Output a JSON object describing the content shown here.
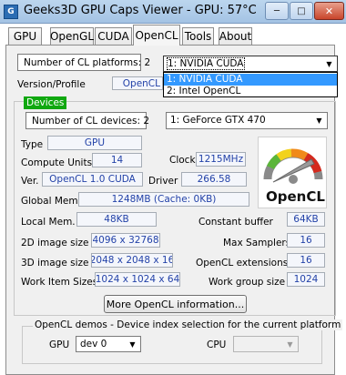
{
  "window": {
    "title": "Geeks3D GPU Caps Viewer - GPU: 57°C",
    "icon_label": "G",
    "controls": {
      "minimize": "─",
      "maximize": "□",
      "close": "✕"
    }
  },
  "tabs": [
    {
      "label": "GPU"
    },
    {
      "label": "OpenGL"
    },
    {
      "label": "CUDA"
    },
    {
      "label": "OpenCL",
      "active": true
    },
    {
      "label": "Tools"
    },
    {
      "label": "About"
    }
  ],
  "platform": {
    "count_label": "Number of CL platforms: 2",
    "selected": "1: NVIDIA CUDA",
    "options": [
      "1: NVIDIA CUDA",
      "2: Intel OpenCL"
    ],
    "version_label": "Version/Profile",
    "version_value": "OpenCL"
  },
  "devices": {
    "group_title": "Devices",
    "count_label": "Number of CL devices: 2",
    "selected": "1: GeForce GTX 470",
    "type_label": "Type",
    "type_value": "GPU",
    "compute_units_label": "Compute Units",
    "compute_units_value": "14",
    "clock_label": "Clock",
    "clock_value": "1215MHz",
    "ver_label": "Ver.",
    "ver_value": "OpenCL 1.0 CUDA",
    "driver_label": "Driver",
    "driver_value": "266.58",
    "global_mem_label": "Global Mem.",
    "global_mem_value": "1248MB (Cache: 0KB)",
    "local_mem_label": "Local Mem.",
    "local_mem_value": "48KB",
    "constant_buffer_label": "Constant buffer",
    "constant_buffer_value": "64KB",
    "image2d_label": "2D image size",
    "image2d_value": "4096 x 32768",
    "max_samplers_label": "Max Samplers",
    "max_samplers_value": "16",
    "image3d_label": "3D image size",
    "image3d_value": "2048 x 2048 x 16",
    "extensions_label": "OpenCL extensions",
    "extensions_value": "16",
    "work_item_label": "Work Item Sizes",
    "work_item_value": "1024 x 1024 x 64",
    "work_group_label": "Work group size",
    "work_group_value": "1024",
    "more_info_button": "More OpenCL information..."
  },
  "logo": {
    "text": "OpenCL",
    "colors": {
      "accent_red": "#d42a1e",
      "accent_orange": "#f08a1a",
      "accent_yellow": "#f2d21c",
      "accent_green": "#5bb53a",
      "dial_gray": "#8a8a8a"
    }
  },
  "demos": {
    "group_title": "OpenCL demos - Device index selection for the current platform",
    "gpu_label": "GPU",
    "gpu_selected": "dev 0",
    "cpu_label": "CPU",
    "cpu_selected": ""
  },
  "colors": {
    "group_title_bg": "#10a810",
    "selection_bg": "#3399ff",
    "value_text": "#2342a8"
  }
}
